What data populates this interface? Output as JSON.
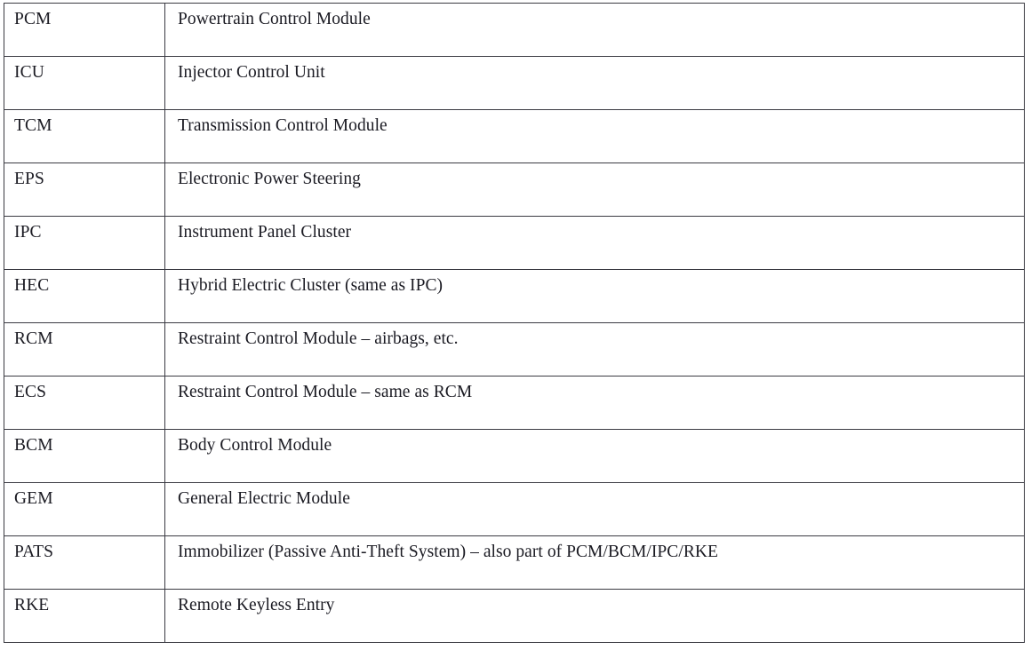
{
  "document": {
    "type": "glossary-table",
    "background_color": "#ffffff",
    "text_color": "#1a1a22",
    "border_color": "#3a3a42"
  },
  "table": {
    "columns": [
      {
        "key": "abbreviation",
        "header": ""
      },
      {
        "key": "definition",
        "header": ""
      }
    ],
    "rows": [
      {
        "abbreviation": "PCM",
        "definition": "Powertrain Control Module"
      },
      {
        "abbreviation": "ICU",
        "definition": "Injector Control Unit"
      },
      {
        "abbreviation": "TCM",
        "definition": "Transmission Control Module"
      },
      {
        "abbreviation": "EPS",
        "definition": "Electronic Power Steering"
      },
      {
        "abbreviation": "IPC",
        "definition": "Instrument Panel Cluster"
      },
      {
        "abbreviation": "HEC",
        "definition": "Hybrid Electric Cluster (same as IPC)"
      },
      {
        "abbreviation": "RCM",
        "definition": "Restraint Control Module – airbags, etc."
      },
      {
        "abbreviation": "ECS",
        "definition": "Restraint Control Module – same as RCM"
      },
      {
        "abbreviation": "BCM",
        "definition": "Body Control Module"
      },
      {
        "abbreviation": "GEM",
        "definition": "General Electric Module"
      },
      {
        "abbreviation": "PATS",
        "definition": "Immobilizer (Passive Anti-Theft System) – also part of PCM/BCM/IPC/RKE"
      },
      {
        "abbreviation": "RKE",
        "definition": "Remote Keyless Entry"
      }
    ]
  }
}
